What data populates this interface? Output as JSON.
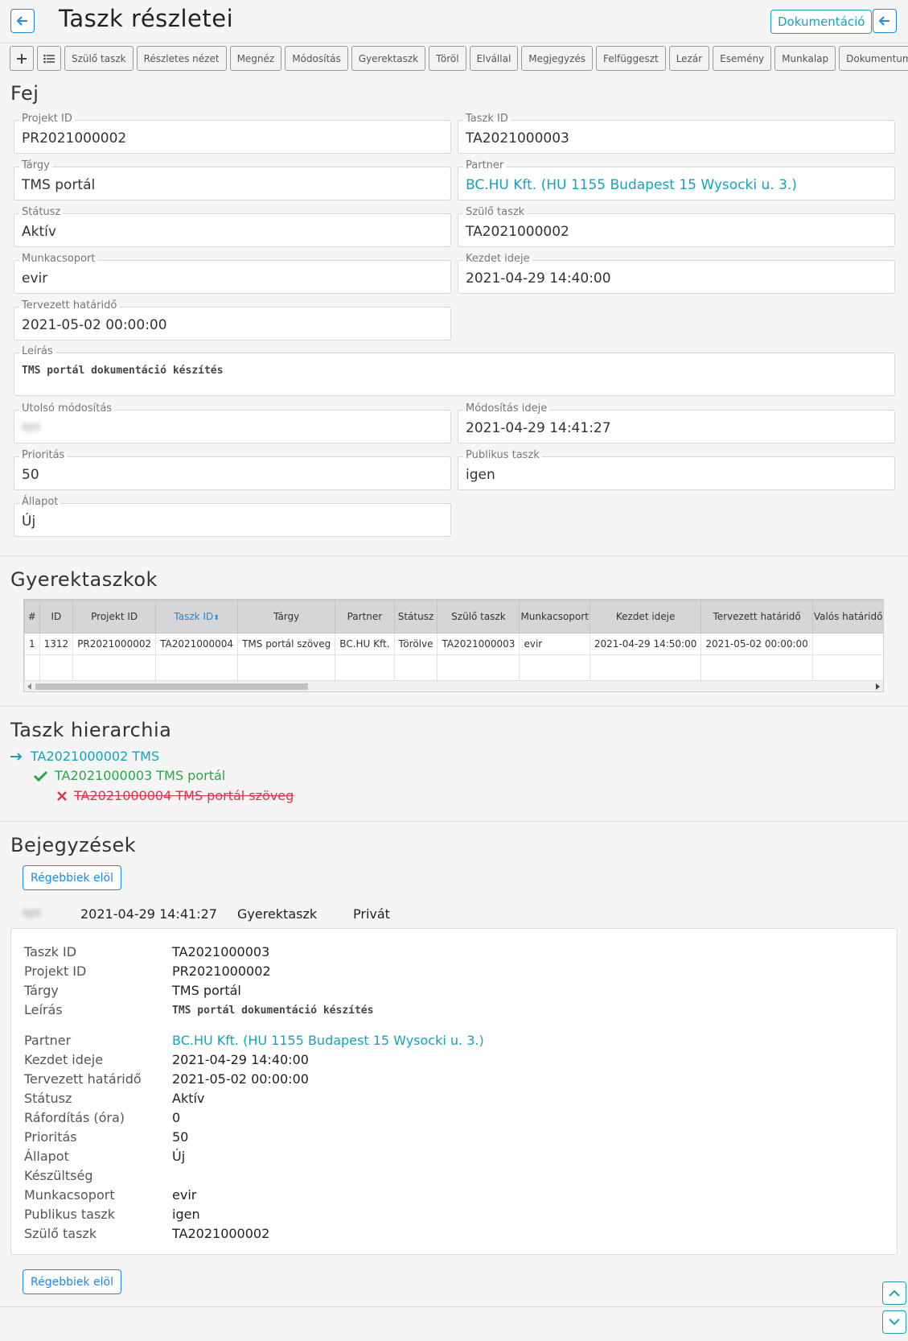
{
  "header": {
    "title": "Taszk részletei",
    "documentation_label": "Dokumentáció"
  },
  "toolbar": {
    "buttons": [
      "Szülő taszk",
      "Részletes nézet",
      "Megnéz",
      "Módosítás",
      "Gyerektaszk",
      "Töröl",
      "Elvállal",
      "Megjegyzés",
      "Felfüggeszt",
      "Lezár",
      "Esemény",
      "Munkalap",
      "Dokumentumok"
    ]
  },
  "fej": {
    "title": "Fej",
    "projekt_id": {
      "label": "Projekt ID",
      "value": "PR2021000002"
    },
    "taszk_id": {
      "label": "Taszk ID",
      "value": "TA2021000003"
    },
    "targy": {
      "label": "Tárgy",
      "value": "TMS portál"
    },
    "partner": {
      "label": "Partner",
      "value": "BC.HU Kft. (HU 1155 Budapest 15 Wysocki u. 3.)"
    },
    "statusz": {
      "label": "Státusz",
      "value": "Aktív"
    },
    "szulo_taszk": {
      "label": "Szülő taszk",
      "value": "TA2021000002"
    },
    "munkacsoport": {
      "label": "Munkacsoport",
      "value": "evir"
    },
    "kezdet_ideje": {
      "label": "Kezdet ideje",
      "value": "2021-04-29 14:40:00"
    },
    "tervezett_hatarido": {
      "label": "Tervezett határidő",
      "value": "2021-05-02 00:00:00"
    },
    "leiras": {
      "label": "Leírás",
      "value": "TMS portál dokumentáció készítés"
    },
    "utolso_modositas": {
      "label": "Utolsó módosítás",
      "value": "sys"
    },
    "modositas_ideje": {
      "label": "Módosítás ideje",
      "value": "2021-04-29 14:41:27"
    },
    "prioritas": {
      "label": "Prioritás",
      "value": "50"
    },
    "publikus_taszk": {
      "label": "Publikus taszk",
      "value": "igen"
    },
    "allapot": {
      "label": "Állapot",
      "value": "Új"
    }
  },
  "gyerektaszkok": {
    "title": "Gyerektaszkok",
    "columns": [
      "#",
      "ID",
      "Projekt ID",
      "Taszk ID",
      "Tárgy",
      "Partner",
      "Státusz",
      "Szülő taszk",
      "Munkacsoport",
      "Kezdet ideje",
      "Tervezett határidő",
      "Valós határidő"
    ],
    "sort_glyph": "⬍",
    "rows": [
      [
        "1",
        "1312",
        "PR2021000002",
        "TA2021000004",
        "TMS portál szöveg",
        "BC.HU Kft.",
        "Törölve",
        "TA2021000003",
        "evir",
        "2021-04-29 14:50:00",
        "2021-05-02 00:00:00",
        ""
      ]
    ]
  },
  "hierarchia": {
    "title": "Taszk hierarchia",
    "items": [
      {
        "text": "TA2021000002 TMS",
        "color": "#17a2b8",
        "icon": "arrow-right-icon"
      },
      {
        "text": "TA2021000003 TMS portál",
        "color": "#28a745",
        "icon": "check-icon"
      },
      {
        "text": "TA2021000004 TMS portál szöveg",
        "color": "#dc3545",
        "icon": "x-icon"
      }
    ]
  },
  "bejegyzesek": {
    "title": "Bejegyzések",
    "older_first_label": "Régebbiek elöl",
    "entry": {
      "user": "sys",
      "timestamp": "2021-04-29 14:41:27",
      "type": "Gyerektaszk",
      "visibility": "Privát",
      "details": [
        {
          "k": "Taszk ID",
          "v": "TA2021000003"
        },
        {
          "k": "Projekt ID",
          "v": "PR2021000002"
        },
        {
          "k": "Tárgy",
          "v": "TMS portál"
        },
        {
          "k": "Leírás",
          "v": "TMS portál dokumentáció készítés"
        },
        {
          "k": "Partner",
          "v": "BC.HU Kft. (HU 1155 Budapest 15 Wysocki u. 3.)"
        },
        {
          "k": "Kezdet ideje",
          "v": "2021-04-29 14:40:00"
        },
        {
          "k": "Tervezett határidő",
          "v": "2021-05-02 00:00:00"
        },
        {
          "k": "Státusz",
          "v": "Aktív"
        },
        {
          "k": "Ráfordítás (óra)",
          "v": "0"
        },
        {
          "k": "Prioritás",
          "v": "50"
        },
        {
          "k": "Állapot",
          "v": "Új"
        },
        {
          "k": "Készültség",
          "v": ""
        },
        {
          "k": "Munkacsoport",
          "v": "evir"
        },
        {
          "k": "Publikus taszk",
          "v": "igen"
        },
        {
          "k": "Szülő taszk",
          "v": "TA2021000002"
        }
      ]
    }
  },
  "colors": {
    "accent": "#17a2b8",
    "primary": "#1e88e5",
    "success": "#28a745",
    "danger": "#dc3545"
  }
}
